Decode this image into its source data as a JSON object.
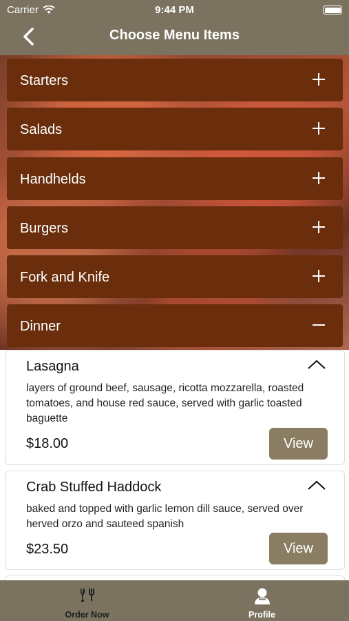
{
  "status_bar": {
    "carrier": "Carrier",
    "time": "9:44 PM"
  },
  "header": {
    "title": "Choose Menu Items"
  },
  "categories": [
    {
      "label": "Starters",
      "expanded": false
    },
    {
      "label": "Salads",
      "expanded": false
    },
    {
      "label": "Handhelds",
      "expanded": false
    },
    {
      "label": "Burgers",
      "expanded": false
    },
    {
      "label": "Fork and Knife",
      "expanded": false
    },
    {
      "label": "Dinner",
      "expanded": true
    }
  ],
  "items": [
    {
      "name": "Lasagna",
      "description": "layers of ground beef, sausage, ricotta mozzarella, roasted tomatoes, and house red sauce, served with garlic toasted baguette",
      "price": "$18.00",
      "button": "View"
    },
    {
      "name": "Crab Stuffed Haddock",
      "description": "baked and topped with garlic lemon dill sauce, served over herved orzo and sauteed spanish",
      "price": "$23.50",
      "button": "View"
    }
  ],
  "tabs": [
    {
      "label": "Order Now",
      "icon": "dining-icon",
      "active": false
    },
    {
      "label": "Profile",
      "icon": "profile-icon",
      "active": true
    }
  ],
  "colors": {
    "header": "#7b7360",
    "category": "#6a2e0c",
    "button": "#8a7d62",
    "active_tab": "#ffffff",
    "inactive_tab": "#1e1e1e"
  }
}
